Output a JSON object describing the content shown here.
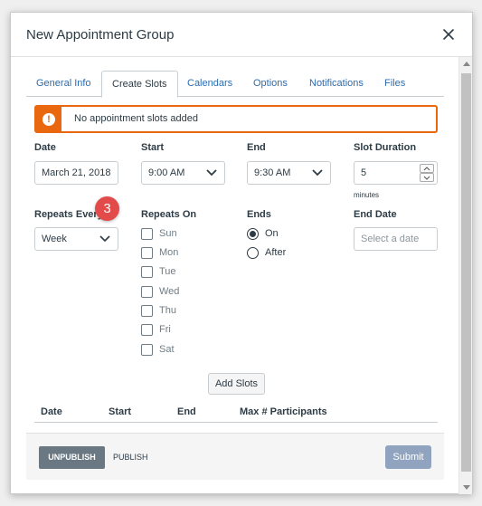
{
  "dialog": {
    "title": "New Appointment Group"
  },
  "tabs": [
    {
      "label": "General Info"
    },
    {
      "label": "Create Slots"
    },
    {
      "label": "Calendars"
    },
    {
      "label": "Options"
    },
    {
      "label": "Notifications"
    },
    {
      "label": "Files"
    }
  ],
  "active_tab": "Create Slots",
  "alert": {
    "text": "No appointment slots added",
    "icon": "!"
  },
  "form": {
    "date": {
      "label": "Date",
      "value": "March 21, 2018"
    },
    "start": {
      "label": "Start",
      "value": "9:00 AM"
    },
    "end": {
      "label": "End",
      "value": "9:30 AM"
    },
    "slot_duration": {
      "label": "Slot Duration",
      "value": "5",
      "unit": "minutes"
    },
    "repeats_every": {
      "label": "Repeats Every",
      "value": "Week"
    },
    "repeats_on": {
      "label": "Repeats On",
      "days": [
        "Sun",
        "Mon",
        "Tue",
        "Wed",
        "Thu",
        "Fri",
        "Sat"
      ]
    },
    "ends": {
      "label": "Ends",
      "options": [
        "On",
        "After"
      ],
      "selected": "On"
    },
    "end_date": {
      "label": "End Date",
      "placeholder": "Select a date"
    }
  },
  "callout_badge": "3",
  "add_slots_label": "Add Slots",
  "table": {
    "headers": [
      "Date",
      "Start",
      "End",
      "Max # Participants"
    ]
  },
  "footer": {
    "unpublish": "UNPUBLISH",
    "publish": "PUBLISH",
    "submit": "Submit"
  },
  "colors": {
    "alert": "#e8670f",
    "badge": "#e34b4b",
    "submit": "#90a4bf",
    "unpublish": "#6a7883"
  }
}
